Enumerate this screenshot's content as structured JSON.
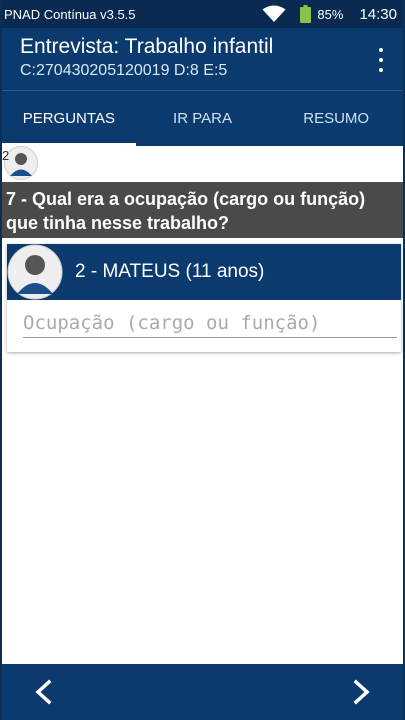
{
  "status_bar": {
    "app_name": "PNAD Contínua v3.5.5",
    "battery_percent": "85%",
    "time": "14:30",
    "icons": [
      "wifi-icon",
      "battery-icon"
    ]
  },
  "app_bar": {
    "title": "Entrevista: Trabalho infantil",
    "subtitle": "C:270430205120019 D:8 E:5",
    "menu_icon": "more-vert-icon"
  },
  "tabs": [
    {
      "label": "PERGUNTAS",
      "active": true
    },
    {
      "label": "IR PARA",
      "active": false
    },
    {
      "label": "RESUMO",
      "active": false
    }
  ],
  "person_strip": {
    "number": "2"
  },
  "question": {
    "text": "7 - Qual era a ocupação (cargo ou função) que tinha nesse trabalho?"
  },
  "card": {
    "person_label": "2 - MATEUS (11 anos)",
    "field_value": "",
    "field_placeholder": "Ocupação (cargo ou função)"
  },
  "bottom_nav": {
    "prev_icon": "chevron-left-icon",
    "next_icon": "chevron-right-icon"
  },
  "colors": {
    "status_bar": "#0a2a52",
    "primary": "#0b3b6e",
    "question_bg": "#4a4a4a",
    "battery": "#8bc34a"
  }
}
